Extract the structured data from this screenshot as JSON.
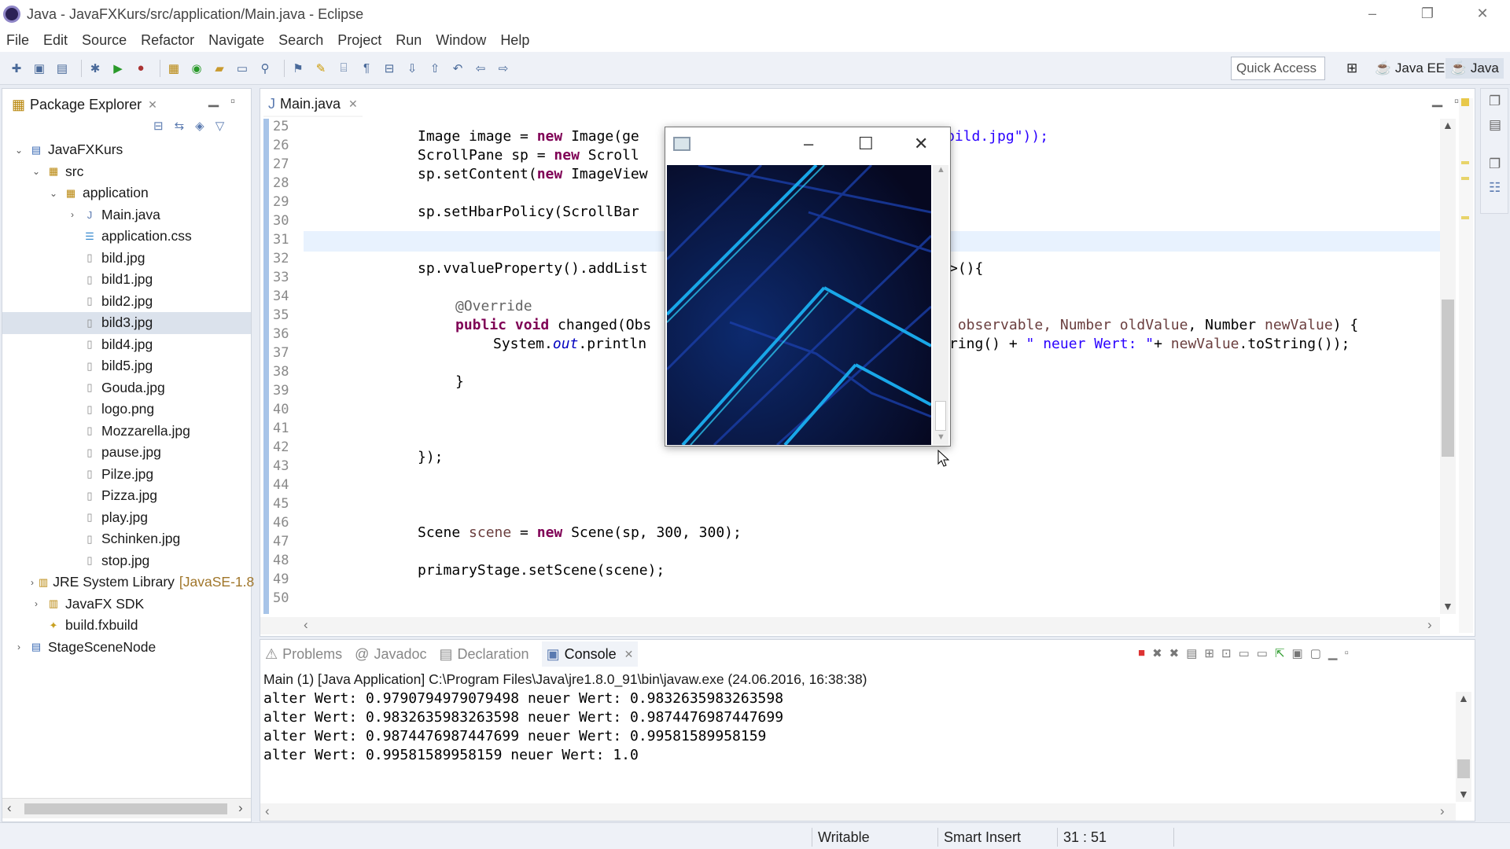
{
  "window": {
    "title": "Java - JavaFXKurs/src/application/Main.java - Eclipse",
    "buttons": [
      "–",
      "❐",
      "✕"
    ]
  },
  "menu": [
    "File",
    "Edit",
    "Source",
    "Refactor",
    "Navigate",
    "Search",
    "Project",
    "Run",
    "Window",
    "Help"
  ],
  "toolbar": {
    "quick_access_placeholder": "Quick Access",
    "perspective_javaee": "Java EE",
    "perspective_java": "Java"
  },
  "package_explorer": {
    "tab_label": "Package Explorer",
    "tree": [
      {
        "label": "JavaFXKurs",
        "twisty": "⌄",
        "icon": "project-icon"
      },
      {
        "label": "src",
        "twisty": "⌄",
        "icon": "source-folder-icon"
      },
      {
        "label": "application",
        "twisty": "⌄",
        "icon": "package-icon"
      },
      {
        "label": "Main.java",
        "twisty": "›",
        "icon": "java-file-icon"
      },
      {
        "label": "application.css",
        "twisty": "",
        "icon": "css-file-icon"
      },
      {
        "label": "bild.jpg",
        "twisty": "",
        "icon": "file-icon"
      },
      {
        "label": "bild1.jpg",
        "twisty": "",
        "icon": "file-icon"
      },
      {
        "label": "bild2.jpg",
        "twisty": "",
        "icon": "file-icon"
      },
      {
        "label": "bild3.jpg",
        "twisty": "",
        "icon": "file-icon",
        "selected": true
      },
      {
        "label": "bild4.jpg",
        "twisty": "",
        "icon": "file-icon"
      },
      {
        "label": "bild5.jpg",
        "twisty": "",
        "icon": "file-icon"
      },
      {
        "label": "Gouda.jpg",
        "twisty": "",
        "icon": "file-icon"
      },
      {
        "label": "logo.png",
        "twisty": "",
        "icon": "file-icon"
      },
      {
        "label": "Mozzarella.jpg",
        "twisty": "",
        "icon": "file-icon"
      },
      {
        "label": "pause.jpg",
        "twisty": "",
        "icon": "file-icon"
      },
      {
        "label": "Pilze.jpg",
        "twisty": "",
        "icon": "file-icon"
      },
      {
        "label": "Pizza.jpg",
        "twisty": "",
        "icon": "file-icon"
      },
      {
        "label": "play.jpg",
        "twisty": "",
        "icon": "file-icon"
      },
      {
        "label": "Schinken.jpg",
        "twisty": "",
        "icon": "file-icon"
      },
      {
        "label": "stop.jpg",
        "twisty": "",
        "icon": "file-icon"
      },
      {
        "label": "JRE System Library",
        "suffix": "[JavaSE-1.8",
        "twisty": "›",
        "icon": "library-icon"
      },
      {
        "label": "JavaFX SDK",
        "twisty": "›",
        "icon": "library-icon"
      },
      {
        "label": "build.fxbuild",
        "twisty": "",
        "icon": "fxbuild-file-icon"
      },
      {
        "label": "StageSceneNode",
        "twisty": "›",
        "icon": "project-icon"
      }
    ]
  },
  "editor": {
    "tab_label": "Main.java",
    "line_numbers": [
      "25",
      "26",
      "27",
      "28",
      "29",
      "30",
      "31",
      "32",
      "33",
      "34",
      "35",
      "36",
      "37",
      "38",
      "39",
      "40",
      "41",
      "42",
      "43",
      "44",
      "45",
      "46",
      "47",
      "48",
      "49",
      "50"
    ],
    "code": {
      "l27a": "Image image = ",
      "l27kw": "new",
      "l27b": " Image(ge",
      "l27c": "bild.jpg\"));",
      "l28a": "ScrollPane sp = ",
      "l28kw": "new",
      "l28b": " Scroll",
      "l29a": "sp.setContent(",
      "l29kw": "new",
      "l29b": " ImageView",
      "l31a": "sp.setHbarPolicy(ScrollBar",
      "l34a": "sp.vvalueProperty().addList",
      "l34b": ">(){",
      "l36a": "@Override",
      "l37kw": "public void",
      "l37b": " changed(Obs",
      "l37c": " observable, Number ",
      "l37v1": "oldValue",
      "l37d": ", Number ",
      "l37v2": "newValue",
      "l37e": ") {",
      "l38a": "System.",
      "l38f": "out",
      "l38b": ".println",
      "l38c": "ring() + ",
      "l38s": "\" neuer Wert: \"",
      "l38d": "+ ",
      "l38v": "newValue",
      "l38e": ".toString());",
      "l40a": "}",
      "l44a": "});",
      "l48a": "Scene ",
      "l48v": "scene",
      "l48b": " = ",
      "l48kw": "new",
      "l48c": " Scene(sp, 300, 300);",
      "l50a": "primaryStage.setScene(scene);"
    }
  },
  "fx_window": {
    "buttons": [
      "–",
      "☐",
      "✕"
    ]
  },
  "bottom_panel": {
    "tabs": [
      "Problems",
      "Javadoc",
      "Declaration",
      "Console"
    ],
    "header": "Main (1) [Java Application] C:\\Program Files\\Java\\jre1.8.0_91\\bin\\javaw.exe (24.06.2016, 16:38:38)",
    "lines": [
      "alter Wert: 0.9790794979079498 neuer Wert: 0.9832635983263598",
      "alter Wert: 0.9832635983263598 neuer Wert: 0.9874476987447699",
      "alter Wert: 0.9874476987447699 neuer Wert: 0.99581589958159",
      "alter Wert: 0.99581589958159 neuer Wert: 1.0"
    ]
  },
  "status": {
    "writable": "Writable",
    "insert_mode": "Smart Insert",
    "position": "31 : 51"
  },
  "colors": {
    "keyword": "#7f0055",
    "string": "#2a00ff",
    "field": "#0000c0",
    "selection": "#dbe2ec",
    "current_line": "#e8f2fe"
  }
}
